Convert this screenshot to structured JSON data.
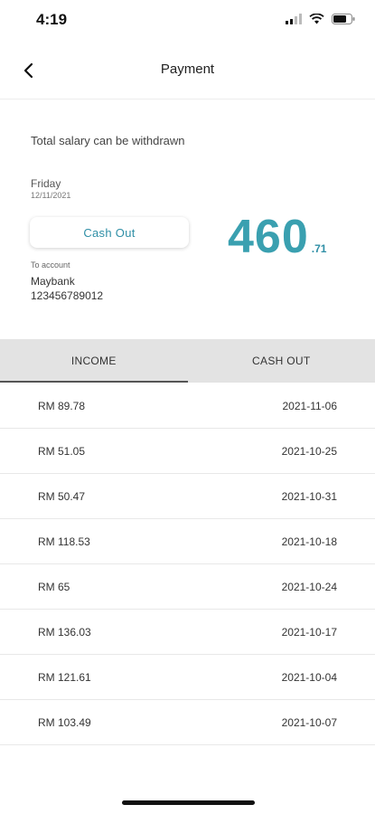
{
  "status_bar": {
    "time": "4:19",
    "icons": [
      "signal-icon",
      "wifi-icon",
      "battery-icon"
    ]
  },
  "header": {
    "title": "Payment",
    "back_icon": "chevron-left-icon"
  },
  "summary": {
    "title": "Total salary can be withdrawn",
    "day": "Friday",
    "date": "12/11/2021",
    "cashout_label": "Cash Out",
    "account_label": "To account",
    "bank": "Maybank",
    "account_number": "123456789012",
    "amount_integer": "460",
    "amount_decimal": ".71",
    "accent_color": "#3aa0b0"
  },
  "tabs": [
    {
      "label": "INCOME",
      "active": true
    },
    {
      "label": "CASH OUT",
      "active": false
    }
  ],
  "transactions": [
    {
      "amount": "RM 89.78",
      "date": "2021-11-06"
    },
    {
      "amount": "RM 51.05",
      "date": "2021-10-25"
    },
    {
      "amount": "RM 50.47",
      "date": "2021-10-31"
    },
    {
      "amount": "RM 118.53",
      "date": "2021-10-18"
    },
    {
      "amount": "RM 65",
      "date": "2021-10-24"
    },
    {
      "amount": "RM 136.03",
      "date": "2021-10-17"
    },
    {
      "amount": "RM 121.61",
      "date": "2021-10-04"
    },
    {
      "amount": "RM 103.49",
      "date": "2021-10-07"
    }
  ]
}
